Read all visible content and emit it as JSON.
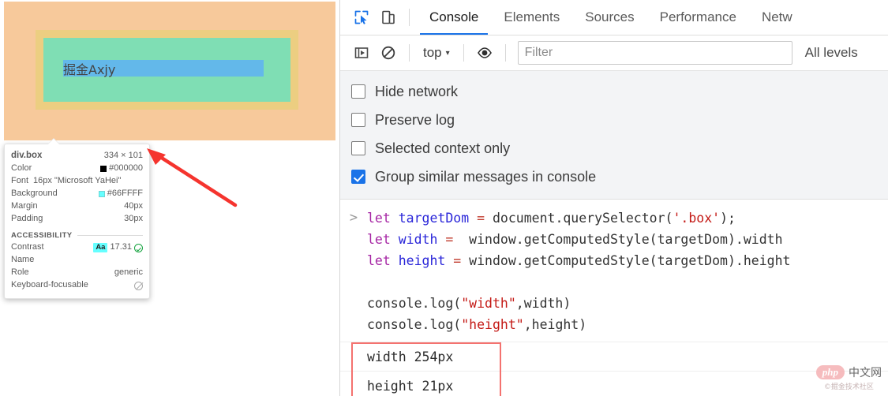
{
  "page_preview": {
    "text_content": "掘金Axjy",
    "overlay": {
      "margin_color": "#f7c99b",
      "padding_color": "#ecce81",
      "content_color": "#7fdeb4",
      "text_highlight_color": "#63b8ea"
    }
  },
  "inspector_tooltip": {
    "selector": "div.box",
    "dimensions": "334 × 101",
    "rows": [
      {
        "key": "Color",
        "value": "#000000",
        "swatch": "#000000"
      },
      {
        "key": "Font",
        "value": "16px \"Microsoft YaHei\"",
        "swatch": null
      },
      {
        "key": "Background",
        "value": "#66FFFF",
        "swatch": "#66FFFF"
      },
      {
        "key": "Margin",
        "value": "40px",
        "swatch": null
      },
      {
        "key": "Padding",
        "value": "30px",
        "swatch": null
      }
    ],
    "accessibility": {
      "heading": "ACCESSIBILITY",
      "contrast_label": "Contrast",
      "contrast_chip": "Aa",
      "contrast_value": "17.31",
      "contrast_status_icon": "check-circle-icon",
      "name_label": "Name",
      "name_value": "",
      "role_label": "Role",
      "role_value": "generic",
      "keyboard_label": "Keyboard-focusable",
      "keyboard_status_icon": "not-allowed-icon"
    }
  },
  "annotation": {
    "arrow_color": "#f5342e",
    "box_color": "#f4726f"
  },
  "devtools": {
    "toolbar_icons": [
      {
        "name": "inspect-element-icon"
      },
      {
        "name": "device-toolbar-icon"
      }
    ],
    "tabs": [
      {
        "label": "Console",
        "active": true
      },
      {
        "label": "Elements",
        "active": false
      },
      {
        "label": "Sources",
        "active": false
      },
      {
        "label": "Performance",
        "active": false
      },
      {
        "label": "Netw",
        "active": false
      }
    ],
    "filter_bar": {
      "sidebar_toggle_icon": "console-sidebar-icon",
      "clear_console_icon": "clear-console-icon",
      "context_label": "top",
      "context_caret": "▾",
      "eye_icon": "live-expression-icon",
      "filter_placeholder": "Filter",
      "filter_value": "",
      "levels_label": "All levels"
    },
    "settings_checkboxes": [
      {
        "label": "Hide network",
        "checked": false
      },
      {
        "label": "Preserve log",
        "checked": false
      },
      {
        "label": "Selected context only",
        "checked": false
      },
      {
        "label": "Group similar messages in console",
        "checked": true
      }
    ],
    "console_input": {
      "prompt": ">",
      "lines": [
        [
          {
            "t": "let ",
            "c": "kw"
          },
          {
            "t": "targetDom ",
            "c": "var"
          },
          {
            "t": "= ",
            "c": "op"
          },
          {
            "t": "document.querySelector(",
            "c": "plain"
          },
          {
            "t": "'.box'",
            "c": "str"
          },
          {
            "t": ");",
            "c": "plain"
          }
        ],
        [
          {
            "t": "let ",
            "c": "kw"
          },
          {
            "t": "width ",
            "c": "var"
          },
          {
            "t": "=  ",
            "c": "op"
          },
          {
            "t": "window.getComputedStyle(targetDom).width",
            "c": "plain"
          }
        ],
        [
          {
            "t": "let ",
            "c": "kw"
          },
          {
            "t": "height ",
            "c": "var"
          },
          {
            "t": "= ",
            "c": "op"
          },
          {
            "t": "window.getComputedStyle(targetDom).height",
            "c": "plain"
          }
        ],
        [],
        [
          {
            "t": "console.log(",
            "c": "plain"
          },
          {
            "t": "\"width\"",
            "c": "str"
          },
          {
            "t": ",width)",
            "c": "plain"
          }
        ],
        [
          {
            "t": "console.log(",
            "c": "plain"
          },
          {
            "t": "\"height\"",
            "c": "str"
          },
          {
            "t": ",height)",
            "c": "plain"
          }
        ]
      ]
    },
    "console_output": [
      {
        "text": "width 254px"
      },
      {
        "text": "height 21px"
      }
    ]
  },
  "watermark": {
    "badge": "php",
    "title": "中文网",
    "subtitle": "©掘金技术社区"
  }
}
